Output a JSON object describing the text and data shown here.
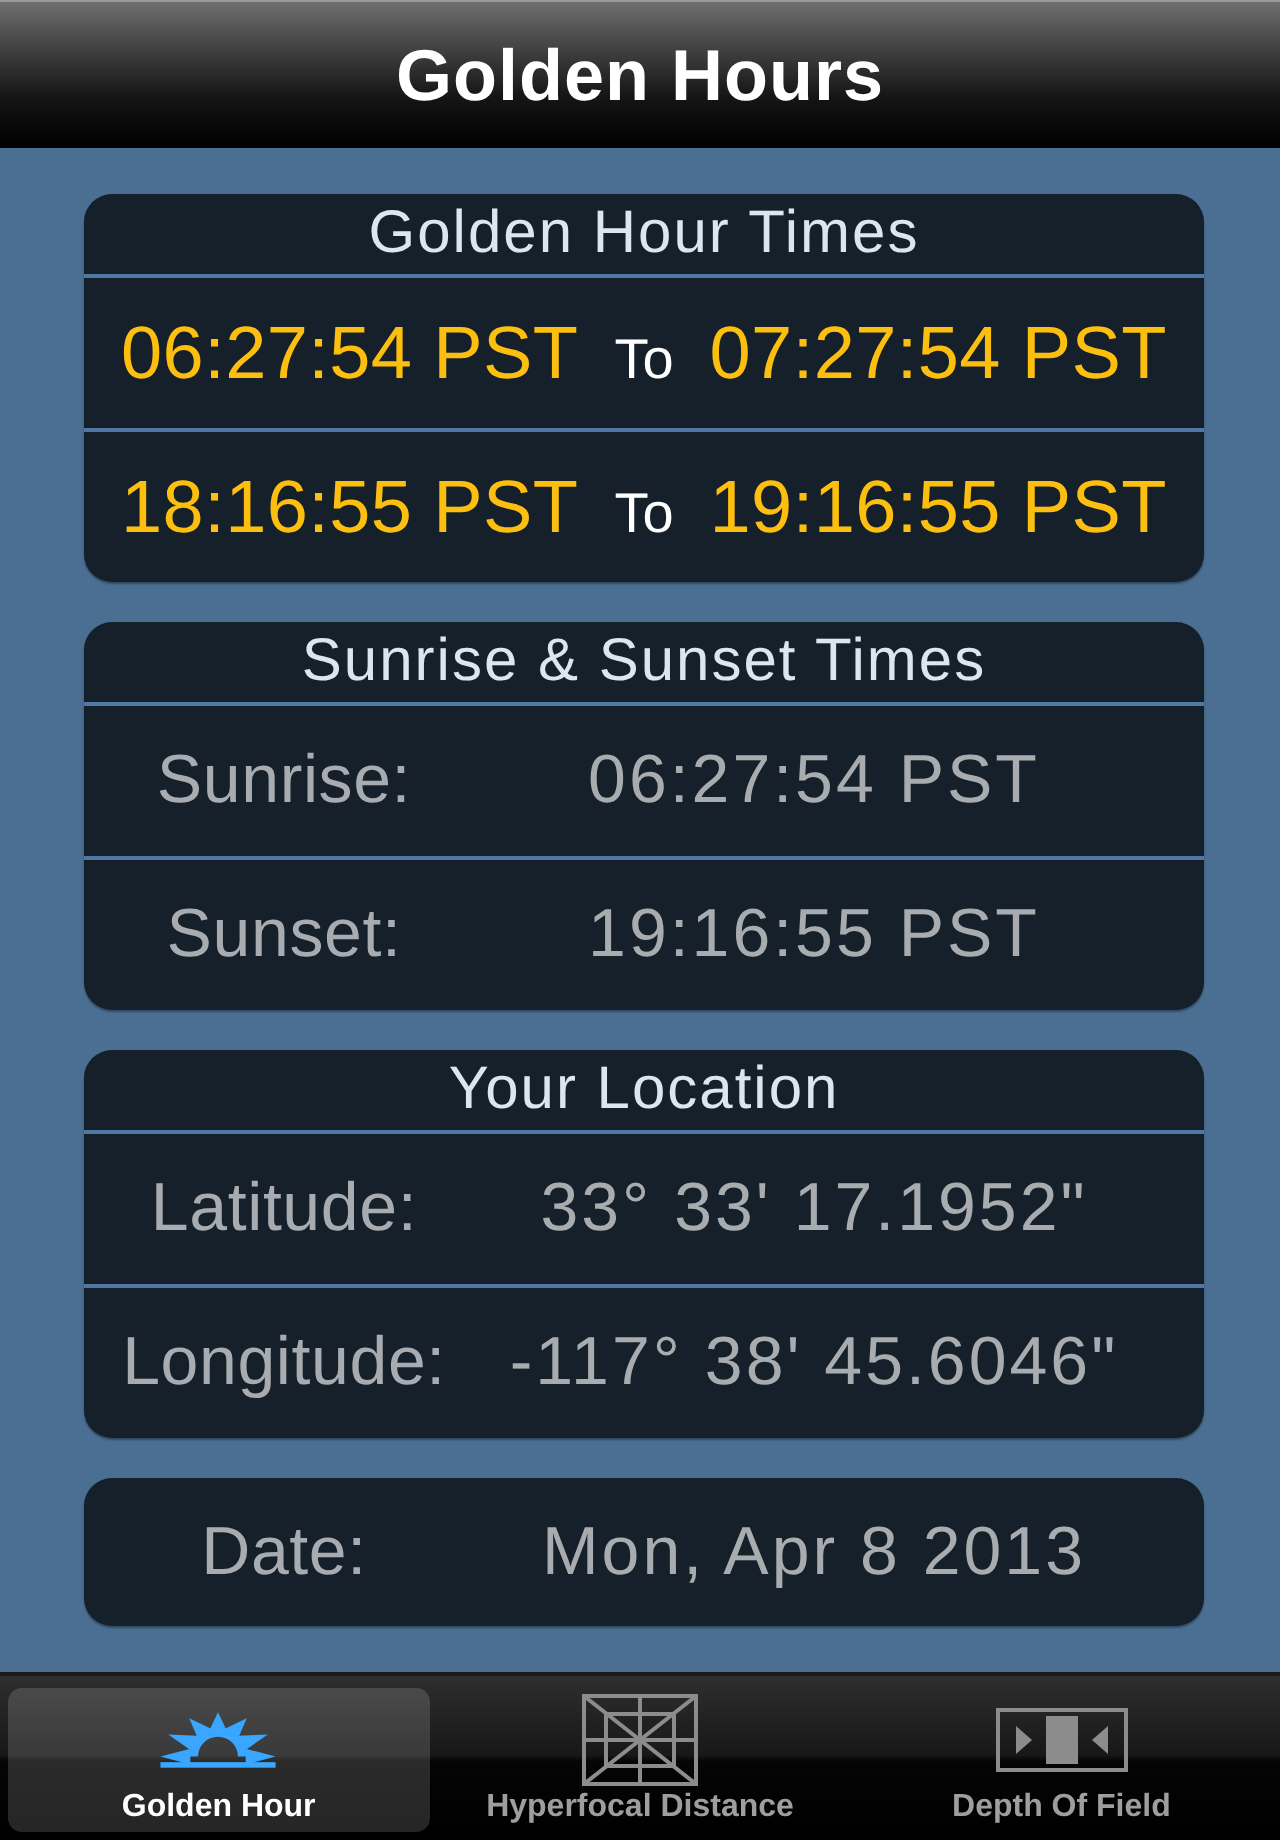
{
  "nav_bar": {
    "title": "Golden Hours"
  },
  "golden_hour_times": {
    "title": "Golden Hour Times",
    "rows": [
      {
        "start": "06:27:54 PST",
        "separator": "To",
        "end": "07:27:54 PST"
      },
      {
        "start": "18:16:55 PST",
        "separator": "To",
        "end": "19:16:55 PST"
      }
    ]
  },
  "sunrise_sunset": {
    "title": "Sunrise & Sunset Times",
    "rows": [
      {
        "label": "Sunrise:",
        "value": "06:27:54 PST"
      },
      {
        "label": "Sunset:",
        "value": "19:16:55 PST"
      }
    ]
  },
  "location": {
    "title": "Your Location",
    "rows": [
      {
        "label": "Latitude:",
        "value": "33° 33' 17.1952\""
      },
      {
        "label": "Longitude:",
        "value": "-117° 38' 45.6046\""
      }
    ]
  },
  "date": {
    "label": "Date:",
    "value": "Mon, Apr 8 2013"
  },
  "tab_bar": {
    "tabs": [
      {
        "label": "Golden Hour",
        "kind": "sunrise",
        "selected": true
      },
      {
        "label": "Hyperfocal Distance",
        "kind": "grid",
        "selected": false
      },
      {
        "label": "Depth Of Field",
        "kind": "focus",
        "selected": false
      }
    ]
  }
}
